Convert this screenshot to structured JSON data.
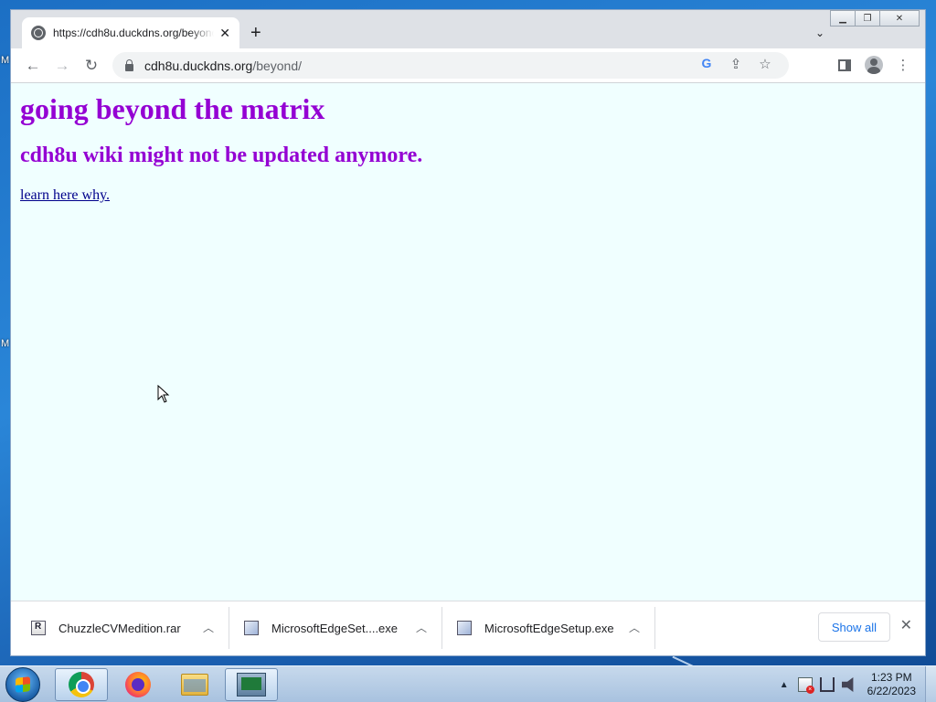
{
  "desktop": {
    "labels": [
      "M",
      "M"
    ]
  },
  "browser": {
    "tab": {
      "title": "https://cdh8u.duckdns.org/beyond/",
      "close_glyph": "✕"
    },
    "new_tab_glyph": "+",
    "address": {
      "host": "cdh8u.duckdns.org",
      "path": "/beyond/"
    },
    "nav": {
      "back": "←",
      "forward": "→",
      "reload": "↻"
    }
  },
  "page": {
    "heading": "going beyond the matrix",
    "subheading": "cdh8u wiki might not be updated anymore.",
    "link_text": "learn here why.",
    "colors": {
      "heading": "#9400d3",
      "link": "#00008b",
      "background": "#f0ffff"
    }
  },
  "downloads": {
    "items": [
      {
        "name": "ChuzzleCVMedition.rar",
        "icon": "rar-archive-icon"
      },
      {
        "name": "MicrosoftEdgeSet....exe",
        "icon": "installer-icon"
      },
      {
        "name": "MicrosoftEdgeSetup.exe",
        "icon": "installer-icon"
      }
    ],
    "show_all": "Show all"
  },
  "taskbar": {
    "apps": [
      "chrome",
      "firefox",
      "file-explorer",
      "app"
    ],
    "clock": {
      "time": "1:23 PM",
      "date": "6/22/2023"
    }
  }
}
